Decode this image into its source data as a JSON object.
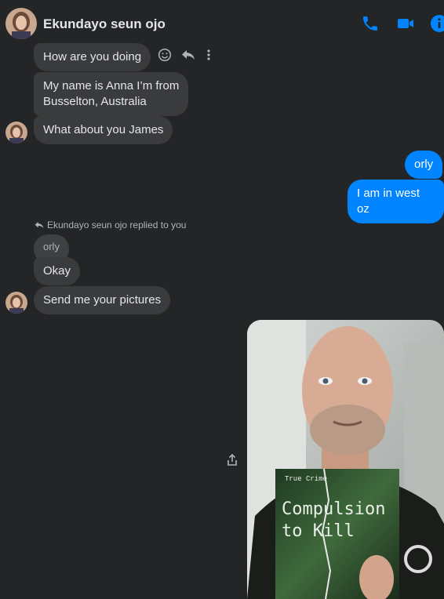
{
  "header": {
    "contact_name": "Ekundayo seun ojo",
    "icons": [
      "phone-icon",
      "video-camera-icon",
      "info-icon"
    ],
    "accent_color": "#0084ff"
  },
  "messages": [
    {
      "from": "contact",
      "text": "How are you doing"
    },
    {
      "from": "contact",
      "text_lines": [
        "My name is Anna I’m from",
        "Busselton, Australia"
      ]
    },
    {
      "from": "contact",
      "text": "What about you James"
    },
    {
      "from": "me",
      "text": "orly"
    },
    {
      "from": "me",
      "text": "I am in west oz"
    },
    {
      "from": "contact",
      "text": "Okay",
      "reply": {
        "label": "Ekundayo seun ojo replied to you",
        "quoted_text": "orly"
      }
    },
    {
      "from": "contact",
      "text": "Send me your pictures"
    },
    {
      "from": "me",
      "type": "photo",
      "book_text": {
        "top": "True Crime",
        "title_line1": "Compulsion",
        "title_line2": "to Kill"
      }
    }
  ],
  "message_actions": [
    "react-smiley-icon",
    "reply-icon",
    "more-options-icon"
  ],
  "colors": {
    "background": "#242526",
    "incoming_bubble": "#3a3b3c",
    "outgoing_bubble": "#0084ff"
  }
}
